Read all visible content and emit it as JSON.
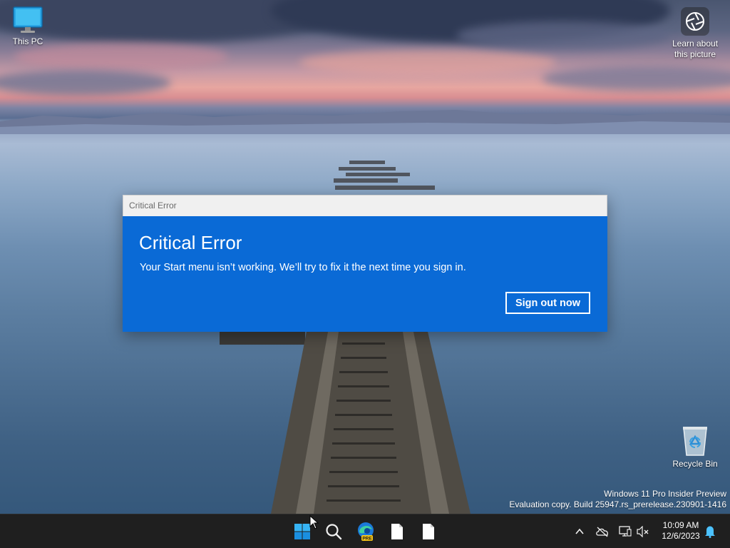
{
  "desktop": {
    "icons": [
      {
        "label": "This PC",
        "icon": "monitor-icon"
      },
      {
        "label": "Learn about this picture",
        "icon": "camera-lens-icon"
      },
      {
        "label": "Recycle Bin",
        "icon": "recycle-bin-icon"
      }
    ],
    "watermark": {
      "line1": "Windows 11 Pro Insider Preview",
      "line2": "Evaluation copy. Build 25947.rs_prerelease.230901-1416"
    }
  },
  "dialog": {
    "window_title": "Critical Error",
    "heading": "Critical Error",
    "message": "Your Start menu isn’t working. We’ll try to fix it the next time you sign in.",
    "button_label": "Sign out now",
    "accent_color": "#0a6ad6"
  },
  "taskbar": {
    "pinned": [
      {
        "name": "start-button",
        "icon": "windows-logo-icon"
      },
      {
        "name": "search-button",
        "icon": "search-icon"
      },
      {
        "name": "edge-preview-button",
        "icon": "edge-icon",
        "badge": "PRE"
      },
      {
        "name": "file-1-button",
        "icon": "document-icon"
      },
      {
        "name": "file-2-button",
        "icon": "document-icon"
      }
    ],
    "tray": [
      {
        "name": "show-hidden-icons",
        "icon": "chevron-up-icon"
      },
      {
        "name": "onedrive",
        "icon": "cloud-offline-icon"
      },
      {
        "name": "network",
        "icon": "network-icon"
      },
      {
        "name": "volume",
        "icon": "speaker-muted-icon"
      }
    ],
    "clock": {
      "time": "10:09 AM",
      "date": "12/6/2023"
    },
    "notifications_icon": "bell-icon"
  }
}
